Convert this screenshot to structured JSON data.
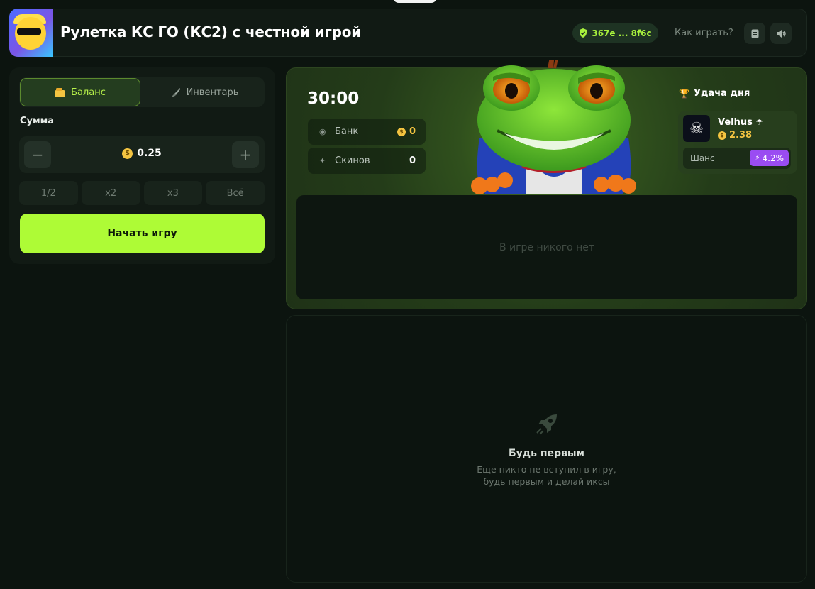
{
  "header": {
    "title": "Рулетка КС ГО (КС2) с честной игрой",
    "hash": "367e ... 8f6c",
    "how_to_play": "Как играть?"
  },
  "bet_panel": {
    "tabs": [
      {
        "label": "Баланс",
        "icon": "wallet-icon",
        "active": true
      },
      {
        "label": "Инвентарь",
        "icon": "knife-icon",
        "active": false
      }
    ],
    "sum_label": "Сумма",
    "amount": "0.25",
    "minus": "−",
    "plus": "+",
    "multipliers": [
      "1/2",
      "x2",
      "x3",
      "Всё"
    ],
    "start_label": "Начать игру"
  },
  "game": {
    "timer": "30:00",
    "bank_label": "Банк",
    "bank_value": "0",
    "skins_label": "Скинов",
    "skins_value": "0",
    "luck_title": "Удача дня",
    "luck_user": "Velhus",
    "luck_amount": "2.38",
    "chance_label": "Шанс",
    "chance_value": "4.2%",
    "empty_players": "В игре никого нет"
  },
  "empty_state": {
    "title": "Будь первым",
    "line1": "Еще никто не вступил в игру,",
    "line2": "будь первым и делай иксы"
  },
  "colors": {
    "accent": "#aefb36",
    "chance": "#9a4cf2",
    "coin": "#f4c441"
  }
}
